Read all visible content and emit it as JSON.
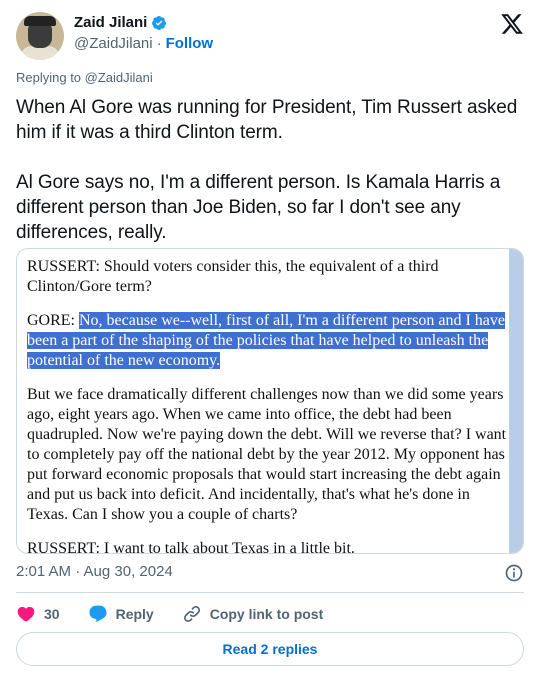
{
  "author": {
    "name": "Zaid Jilani",
    "handle": "@ZaidJilani",
    "separator": "·",
    "follow_label": "Follow"
  },
  "replying_to": "Replying to @ZaidJilani",
  "tweet_text": "When Al Gore was running for President, Tim Russert asked him if it was a third Clinton term.\n\nAl Gore says no, I'm a different person. Is Kamala Harris a different person than Joe Biden, so far I don't see any differences, really.",
  "transcript": {
    "p1": "RUSSERT: Should voters consider this, the equivalent of a third Clinton/Gore term?",
    "p2_prefix": "GORE: ",
    "p2_highlight": "No, because we--well, first of all, I'm a different person and I have been a part of the shaping of the policies that have helped to unleash the potential of the new economy.",
    "p3": "But we face dramatically different challenges now than we did some years ago, eight years ago. When we came into office, the debt had been quadrupled. Now we're paying down the debt. Will we reverse that? I want to completely pay off the national debt by the year 2012. My opponent has put forward economic proposals that would start increasing the debt again and put us back into deficit. And incidentally, that's what he's done in Texas. Can I show you a couple of charts?",
    "p4": "RUSSERT: I want to talk about Texas in a little bit."
  },
  "timestamp": "2:01 AM · Aug 30, 2024",
  "actions": {
    "likes_count": "30",
    "reply_label": "Reply",
    "copy_link_label": "Copy link to post"
  },
  "read_replies_label": "Read 2 replies",
  "colors": {
    "accent": "#006fd6",
    "like": "#f91880",
    "highlight": "#3f6fd0",
    "scrollbar": "#b9cde6"
  },
  "icons": [
    "verified-badge-icon",
    "x-logo-icon",
    "info-icon",
    "heart-icon",
    "reply-bubble-icon",
    "link-icon"
  ]
}
